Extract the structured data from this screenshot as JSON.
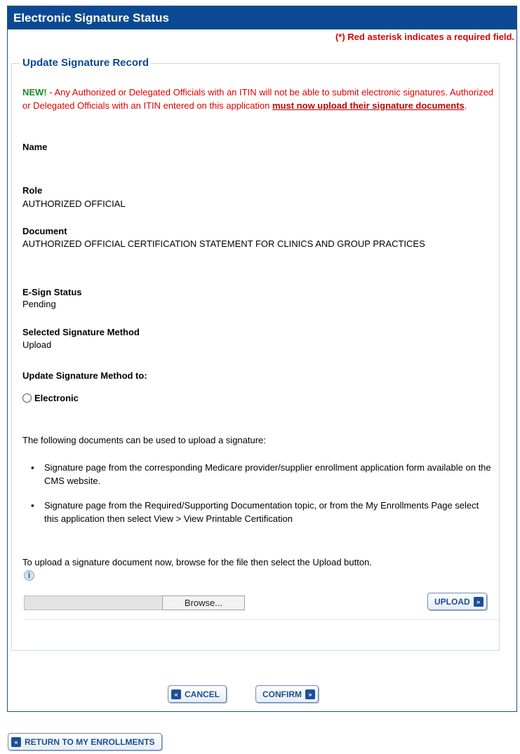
{
  "header": {
    "title": "Electronic Signature Status"
  },
  "required_note": "(*) Red asterisk indicates a required field.",
  "section": {
    "title": "Update Signature Record"
  },
  "notice": {
    "new_label": "NEW!",
    "text": " - Any Authorized or Delegated Officials with an ITIN will not be able to submit electronic signatures. Authorized or Delegated Officials with an ITIN entered on this application ",
    "link_text": "must now upload their signature documents",
    "end": "."
  },
  "fields": {
    "name_label": "Name",
    "name_value": "",
    "role_label": "Role",
    "role_value": "AUTHORIZED OFFICIAL",
    "document_label": "Document",
    "document_value": "AUTHORIZED OFFICIAL CERTIFICATION STATEMENT FOR CLINICS AND GROUP PRACTICES",
    "esign_label": "E-Sign Status",
    "esign_value": "Pending",
    "method_label": "Selected Signature Method",
    "method_value": "Upload",
    "update_label": "Update Signature Method to:"
  },
  "radio": {
    "label": "Electronic",
    "checked": false
  },
  "upload": {
    "intro": "The following documents can be used to upload a signature:",
    "bullets": [
      "Signature page from the corresponding Medicare provider/supplier enrollment application form available on the CMS website.",
      "Signature page from the Required/Supporting Documentation topic, or from the My Enrollments Page select this application then select View > View Printable Certification"
    ],
    "bullet_glyph": "▪",
    "instructions": "To upload a signature document now, browse for the file then select the Upload button.",
    "browse_label": "Browse...",
    "upload_label": "UPLOAD",
    "file_value": ""
  },
  "buttons": {
    "cancel": "CANCEL",
    "confirm": "CONFIRM",
    "return": "RETURN TO MY ENROLLMENTS"
  },
  "icons": {
    "back": "chevron-double-left-icon",
    "forward": "chevron-double-right-icon",
    "info": "info-icon"
  },
  "colors": {
    "header": "#0b4a92",
    "required": "#e00000",
    "new": "#1a8a2a"
  }
}
